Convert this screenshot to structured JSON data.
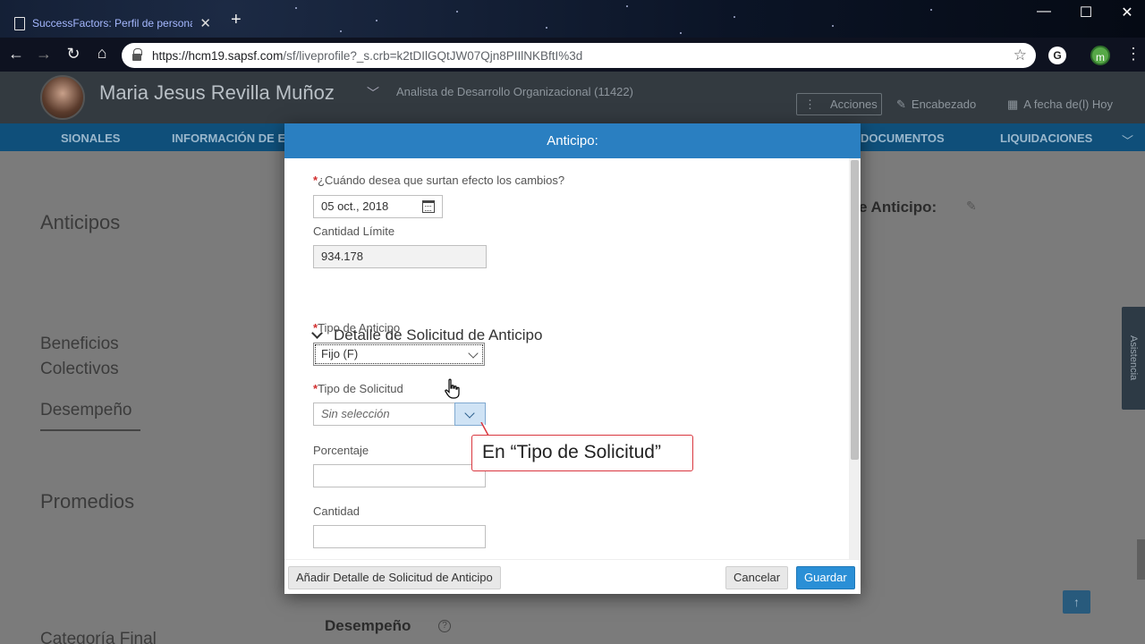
{
  "browser": {
    "tab_title": "SuccessFactors: Perfil de persona",
    "url_host": "https://hcm19.sapsf.com",
    "url_path": "/sf/liveprofile?_s.crb=k2tDIlGQtJW07Qjn8PIIlNKBftI%3d",
    "ext_m_label": "m",
    "ext_g_label": "G"
  },
  "header": {
    "employee_name": "Maria Jesus Revilla Muñoz",
    "employee_title": "Analista de Desarrollo Organizacional (11422)",
    "acciones": "Acciones",
    "encabezado": "Encabezado",
    "fecha": "A fecha de(l) Hoy"
  },
  "nav": {
    "item1": "SIONALES",
    "item2": "INFORMACIÓN DE E",
    "item3": "DOCUMENTOS",
    "item4": "LIQUIDACIONES"
  },
  "sidebar": {
    "anticipos": "Anticipos",
    "beneficios": "Beneficios",
    "colectivos": "Colectivos",
    "desempeno": "Desempeño",
    "promedios": "Promedios",
    "categoria": "Categoría Final"
  },
  "page": {
    "right_heading": "e Anticipo:",
    "desempeno_bottom": "Desempeño",
    "asistencia": "Asistencia"
  },
  "dialog": {
    "title": "Anticipo:",
    "effective_label": "¿Cuándo desea que surtan efecto los cambios?",
    "effective_value": "05 oct., 2018",
    "cantidad_limite_label": "Cantidad Límite",
    "cantidad_limite_value": "934.178",
    "section_title": "Detalle de Solicitud de Anticipo",
    "tipo_anticipo_label": "Tipo de Anticipo",
    "tipo_anticipo_value": "Fijo (F)",
    "tipo_solicitud_label": "Tipo de Solicitud",
    "tipo_solicitud_placeholder": "Sin selección",
    "porcentaje_label": "Porcentaje",
    "cantidad_label": "Cantidad",
    "add_button": "Añadir Detalle de Solicitud de Anticipo",
    "cancel_button": "Cancelar",
    "save_button": "Guardar",
    "required_mark": "*"
  },
  "callout": {
    "text": "En “Tipo de Solicitud”"
  },
  "colors": {
    "dialog_header": "#2a7fc1",
    "save_button": "#2a8fd6",
    "callout_border": "#d9363e"
  }
}
